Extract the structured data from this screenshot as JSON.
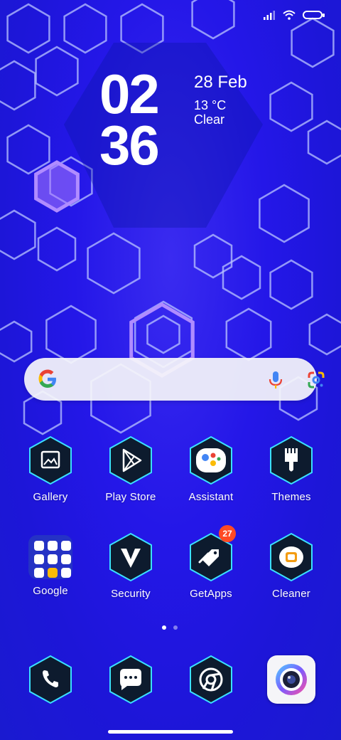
{
  "status_bar": {
    "icons": [
      "signal-icon",
      "wifi-icon",
      "battery-icon"
    ]
  },
  "clock": {
    "hours": "02",
    "minutes": "36",
    "date": "28 Feb",
    "temperature": "13 °C",
    "condition": "Clear"
  },
  "search_bar": {
    "provider_icon": "google-g-icon",
    "actions": [
      "microphone-icon",
      "google-lens-icon"
    ]
  },
  "apps_row1": [
    {
      "label": "Gallery",
      "icon": "gallery-icon"
    },
    {
      "label": "Play Store",
      "icon": "play-store-icon"
    },
    {
      "label": "Assistant",
      "icon": "assistant-icon"
    },
    {
      "label": "Themes",
      "icon": "themes-brush-icon"
    }
  ],
  "apps_row2": [
    {
      "label": "Google",
      "icon": "google-folder-icon"
    },
    {
      "label": "Security",
      "icon": "security-icon"
    },
    {
      "label": "GetApps",
      "icon": "getapps-icon",
      "badge": "27"
    },
    {
      "label": "Cleaner",
      "icon": "cleaner-icon"
    }
  ],
  "page_indicator": {
    "pages": 2,
    "current": 1
  },
  "dock": [
    {
      "name": "phone",
      "icon": "phone-icon"
    },
    {
      "name": "messages",
      "icon": "messages-icon"
    },
    {
      "name": "chrome",
      "icon": "chrome-icon"
    },
    {
      "name": "camera",
      "icon": "camera-icon"
    }
  ],
  "colors": {
    "wallpaper": "#2417e8",
    "hex_outline": "#9fb0ff",
    "hex_highlight": "#a57bff",
    "icon_tile": "#0d1b2e",
    "badge": "#ff4a24"
  }
}
